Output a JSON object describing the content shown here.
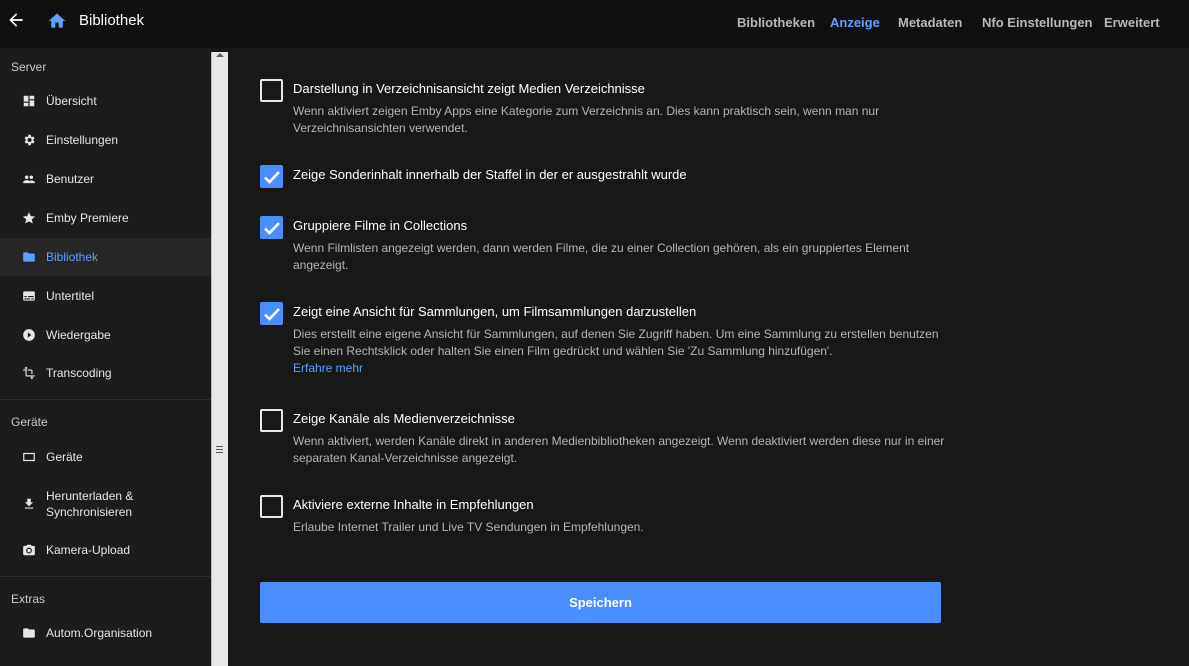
{
  "header": {
    "title": "Bibliothek",
    "tabs": [
      {
        "label": "Bibliotheken",
        "active": false
      },
      {
        "label": "Anzeige",
        "active": true
      },
      {
        "label": "Metadaten",
        "active": false
      },
      {
        "label": "Nfo Einstellungen",
        "active": false
      },
      {
        "label": "Erweitert",
        "active": false
      }
    ]
  },
  "sidebar": {
    "sections": [
      {
        "heading": "Server",
        "items": [
          {
            "label": "Übersicht",
            "icon": "dashboard-icon"
          },
          {
            "label": "Einstellungen",
            "icon": "gear-icon"
          },
          {
            "label": "Benutzer",
            "icon": "people-icon"
          },
          {
            "label": "Emby Premiere",
            "icon": "star-icon"
          },
          {
            "label": "Bibliothek",
            "icon": "folder-icon",
            "active": true
          },
          {
            "label": "Untertitel",
            "icon": "subtitles-icon"
          },
          {
            "label": "Wiedergabe",
            "icon": "play-circle-icon"
          },
          {
            "label": "Transcoding",
            "icon": "transform-icon"
          }
        ]
      },
      {
        "heading": "Geräte",
        "items": [
          {
            "label": "Geräte",
            "icon": "devices-icon"
          },
          {
            "label": "Herunterladen & Synchronisieren",
            "icon": "download-icon"
          },
          {
            "label": "Kamera-Upload",
            "icon": "camera-icon"
          }
        ]
      },
      {
        "heading": "Extras",
        "items": [
          {
            "label": "Autom.Organisation",
            "icon": "folder-icon"
          }
        ]
      }
    ]
  },
  "options": [
    {
      "title": "Darstellung in Verzeichnisansicht zeigt Medien Verzeichnisse",
      "description": "Wenn aktiviert zeigen Emby Apps eine Kategorie zum Verzeichnis an. Dies kann praktisch sein, wenn man nur Verzeichnisansichten verwendet.",
      "checked": false
    },
    {
      "title": "Zeige Sonderinhalt innerhalb der Staffel in der er ausgestrahlt wurde",
      "description": "",
      "checked": true
    },
    {
      "title": "Gruppiere Filme in Collections",
      "description": "Wenn Filmlisten angezeigt werden, dann werden Filme, die zu einer Collection gehören, als ein gruppiertes Element angezeigt.",
      "checked": true
    },
    {
      "title": "Zeigt eine Ansicht für Sammlungen, um Filmsammlungen darzustellen",
      "description": "Dies erstellt eine eigene Ansicht für Sammlungen, auf denen Sie Zugriff haben. Um eine Sammlung zu erstellen benutzen Sie einen Rechtsklick oder halten Sie einen Film gedrückt und wählen Sie 'Zu Sammlung hinzufügen'.",
      "link": "Erfahre mehr",
      "checked": true
    },
    {
      "title": "Zeige Kanäle als Medienverzeichnisse",
      "description": "Wenn aktiviert, werden Kanäle direkt in anderen Medienbibliotheken angezeigt. Wenn deaktiviert werden diese nur in einer separaten Kanal-Verzeichnisse angezeigt.",
      "checked": false
    },
    {
      "title": "Aktiviere externe Inhalte in Empfehlungen",
      "description": "Erlaube Internet Trailer und Live TV Sendungen in Empfehlungen.",
      "checked": false
    }
  ],
  "save_label": "Speichern",
  "colors": {
    "accent": "#4a8dff",
    "link": "#5ea0ff"
  }
}
